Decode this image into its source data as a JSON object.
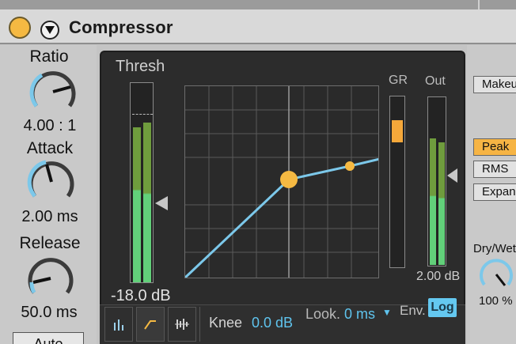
{
  "device": {
    "title": "Compressor",
    "accent_color": "#f5b942",
    "meter_color": "#8ecf5a",
    "curve_color": "#7cc8ea"
  },
  "knobs": {
    "ratio": {
      "label": "Ratio",
      "value": "4.00 : 1"
    },
    "attack": {
      "label": "Attack",
      "value": "2.00 ms"
    },
    "release": {
      "label": "Release",
      "value": "50.0 ms"
    }
  },
  "auto_button": {
    "label": "Auto"
  },
  "display": {
    "thresh_label": "Thresh",
    "thresh_value": "-18.0 dB",
    "gr_label": "GR",
    "out_label": "Out",
    "out_value": "2.00 dB"
  },
  "bottom_bar": {
    "knee_label": "Knee",
    "knee_value": "0.0 dB",
    "look_label": "Look.",
    "look_value": "0 ms",
    "env_label": "Env.",
    "log_label": "Log"
  },
  "right_panel": {
    "makeup_label": "Makeup",
    "peak_label": "Peak",
    "rms_label": "RMS",
    "expand_label": "Expand",
    "drywet_label": "Dry/Wet",
    "drywet_value": "100 %"
  }
}
